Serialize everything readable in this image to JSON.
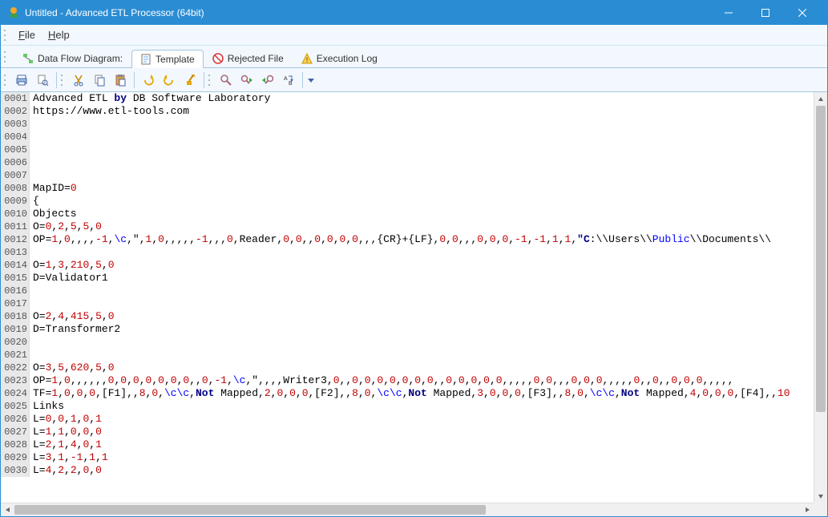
{
  "window": {
    "title": "Untitled - Advanced ETL Processor (64bit)"
  },
  "menu": {
    "file": "File",
    "help": "Help"
  },
  "tabs": {
    "dataflow": "Data Flow Diagram:",
    "template": "Template",
    "rejected": "Rejected File",
    "execlog": "Execution Log"
  },
  "code": {
    "lines": [
      {
        "n": "0001",
        "segs": [
          {
            "t": "Advanced ETL "
          },
          {
            "t": "by",
            "c": "hl-kw"
          },
          {
            "t": " DB Software Laboratory"
          }
        ]
      },
      {
        "n": "0002",
        "segs": [
          {
            "t": "https://www.etl-tools.com"
          }
        ]
      },
      {
        "n": "0003",
        "segs": []
      },
      {
        "n": "0004",
        "segs": []
      },
      {
        "n": "0005",
        "segs": []
      },
      {
        "n": "0006",
        "segs": []
      },
      {
        "n": "0007",
        "segs": []
      },
      {
        "n": "0008",
        "segs": [
          {
            "t": "MapID="
          },
          {
            "t": "0",
            "c": "hl-num"
          }
        ]
      },
      {
        "n": "0009",
        "segs": [
          {
            "t": "{"
          }
        ]
      },
      {
        "n": "0010",
        "segs": [
          {
            "t": "Objects"
          }
        ]
      },
      {
        "n": "0011",
        "segs": [
          {
            "t": "O="
          },
          {
            "t": "0",
            "c": "hl-num"
          },
          {
            "t": ","
          },
          {
            "t": "2",
            "c": "hl-num"
          },
          {
            "t": ","
          },
          {
            "t": "5",
            "c": "hl-num"
          },
          {
            "t": ","
          },
          {
            "t": "5",
            "c": "hl-num"
          },
          {
            "t": ","
          },
          {
            "t": "0",
            "c": "hl-num"
          }
        ]
      },
      {
        "n": "0012",
        "segs": [
          {
            "t": "OP="
          },
          {
            "t": "1",
            "c": "hl-num"
          },
          {
            "t": ","
          },
          {
            "t": "0",
            "c": "hl-num"
          },
          {
            "t": ",,,,"
          },
          {
            "t": "-1",
            "c": "hl-num"
          },
          {
            "t": ","
          },
          {
            "t": "\\c",
            "c": "hl-blue"
          },
          {
            "t": ",\","
          },
          {
            "t": "1",
            "c": "hl-num"
          },
          {
            "t": ","
          },
          {
            "t": "0",
            "c": "hl-num"
          },
          {
            "t": ",,,,,"
          },
          {
            "t": "-1",
            "c": "hl-num"
          },
          {
            "t": ",,,"
          },
          {
            "t": "0",
            "c": "hl-num"
          },
          {
            "t": ",Reader,"
          },
          {
            "t": "0",
            "c": "hl-num"
          },
          {
            "t": ","
          },
          {
            "t": "0",
            "c": "hl-num"
          },
          {
            "t": ",,"
          },
          {
            "t": "0",
            "c": "hl-num"
          },
          {
            "t": ","
          },
          {
            "t": "0",
            "c": "hl-num"
          },
          {
            "t": ","
          },
          {
            "t": "0",
            "c": "hl-num"
          },
          {
            "t": ","
          },
          {
            "t": "0",
            "c": "hl-num"
          },
          {
            "t": ",,,{CR}+{LF},"
          },
          {
            "t": "0",
            "c": "hl-num"
          },
          {
            "t": ","
          },
          {
            "t": "0",
            "c": "hl-num"
          },
          {
            "t": ",,,"
          },
          {
            "t": "0",
            "c": "hl-num"
          },
          {
            "t": ","
          },
          {
            "t": "0",
            "c": "hl-num"
          },
          {
            "t": ","
          },
          {
            "t": "0",
            "c": "hl-num"
          },
          {
            "t": ","
          },
          {
            "t": "-1",
            "c": "hl-num"
          },
          {
            "t": ","
          },
          {
            "t": "-1",
            "c": "hl-num"
          },
          {
            "t": ","
          },
          {
            "t": "1",
            "c": "hl-num"
          },
          {
            "t": ","
          },
          {
            "t": "1",
            "c": "hl-num"
          },
          {
            "t": ","
          },
          {
            "t": "\"C",
            "c": "hl-kw"
          },
          {
            "t": ":\\\\Users\\\\"
          },
          {
            "t": "Public",
            "c": "hl-blue"
          },
          {
            "t": "\\\\Documents\\\\"
          }
        ]
      },
      {
        "n": "0013",
        "segs": []
      },
      {
        "n": "0014",
        "segs": [
          {
            "t": "O="
          },
          {
            "t": "1",
            "c": "hl-num"
          },
          {
            "t": ","
          },
          {
            "t": "3",
            "c": "hl-num"
          },
          {
            "t": ","
          },
          {
            "t": "210",
            "c": "hl-num"
          },
          {
            "t": ","
          },
          {
            "t": "5",
            "c": "hl-num"
          },
          {
            "t": ","
          },
          {
            "t": "0",
            "c": "hl-num"
          }
        ]
      },
      {
        "n": "0015",
        "segs": [
          {
            "t": "D=Validator1"
          }
        ]
      },
      {
        "n": "0016",
        "segs": []
      },
      {
        "n": "0017",
        "segs": []
      },
      {
        "n": "0018",
        "segs": [
          {
            "t": "O="
          },
          {
            "t": "2",
            "c": "hl-num"
          },
          {
            "t": ","
          },
          {
            "t": "4",
            "c": "hl-num"
          },
          {
            "t": ","
          },
          {
            "t": "415",
            "c": "hl-num"
          },
          {
            "t": ","
          },
          {
            "t": "5",
            "c": "hl-num"
          },
          {
            "t": ","
          },
          {
            "t": "0",
            "c": "hl-num"
          }
        ]
      },
      {
        "n": "0019",
        "segs": [
          {
            "t": "D=Transformer2"
          }
        ]
      },
      {
        "n": "0020",
        "segs": []
      },
      {
        "n": "0021",
        "segs": []
      },
      {
        "n": "0022",
        "segs": [
          {
            "t": "O="
          },
          {
            "t": "3",
            "c": "hl-num"
          },
          {
            "t": ","
          },
          {
            "t": "5",
            "c": "hl-num"
          },
          {
            "t": ","
          },
          {
            "t": "620",
            "c": "hl-num"
          },
          {
            "t": ","
          },
          {
            "t": "5",
            "c": "hl-num"
          },
          {
            "t": ","
          },
          {
            "t": "0",
            "c": "hl-num"
          }
        ]
      },
      {
        "n": "0023",
        "segs": [
          {
            "t": "OP="
          },
          {
            "t": "1",
            "c": "hl-num"
          },
          {
            "t": ","
          },
          {
            "t": "0",
            "c": "hl-num"
          },
          {
            "t": ",,,,,,"
          },
          {
            "t": "0",
            "c": "hl-num"
          },
          {
            "t": ","
          },
          {
            "t": "0",
            "c": "hl-num"
          },
          {
            "t": ","
          },
          {
            "t": "0",
            "c": "hl-num"
          },
          {
            "t": ","
          },
          {
            "t": "0",
            "c": "hl-num"
          },
          {
            "t": ","
          },
          {
            "t": "0",
            "c": "hl-num"
          },
          {
            "t": ","
          },
          {
            "t": "0",
            "c": "hl-num"
          },
          {
            "t": ","
          },
          {
            "t": "0",
            "c": "hl-num"
          },
          {
            "t": ",,"
          },
          {
            "t": "0",
            "c": "hl-num"
          },
          {
            "t": ","
          },
          {
            "t": "-1",
            "c": "hl-num"
          },
          {
            "t": ","
          },
          {
            "t": "\\c",
            "c": "hl-blue"
          },
          {
            "t": ",\",,,,Writer3,"
          },
          {
            "t": "0",
            "c": "hl-num"
          },
          {
            "t": ",,"
          },
          {
            "t": "0",
            "c": "hl-num"
          },
          {
            "t": ","
          },
          {
            "t": "0",
            "c": "hl-num"
          },
          {
            "t": ","
          },
          {
            "t": "0",
            "c": "hl-num"
          },
          {
            "t": ","
          },
          {
            "t": "0",
            "c": "hl-num"
          },
          {
            "t": ","
          },
          {
            "t": "0",
            "c": "hl-num"
          },
          {
            "t": ","
          },
          {
            "t": "0",
            "c": "hl-num"
          },
          {
            "t": ","
          },
          {
            "t": "0",
            "c": "hl-num"
          },
          {
            "t": ",,"
          },
          {
            "t": "0",
            "c": "hl-num"
          },
          {
            "t": ","
          },
          {
            "t": "0",
            "c": "hl-num"
          },
          {
            "t": ","
          },
          {
            "t": "0",
            "c": "hl-num"
          },
          {
            "t": ","
          },
          {
            "t": "0",
            "c": "hl-num"
          },
          {
            "t": ","
          },
          {
            "t": "0",
            "c": "hl-num"
          },
          {
            "t": ",,,,,"
          },
          {
            "t": "0",
            "c": "hl-num"
          },
          {
            "t": ","
          },
          {
            "t": "0",
            "c": "hl-num"
          },
          {
            "t": ",,,"
          },
          {
            "t": "0",
            "c": "hl-num"
          },
          {
            "t": ","
          },
          {
            "t": "0",
            "c": "hl-num"
          },
          {
            "t": ","
          },
          {
            "t": "0",
            "c": "hl-num"
          },
          {
            "t": ",,,,,"
          },
          {
            "t": "0",
            "c": "hl-num"
          },
          {
            "t": ",,"
          },
          {
            "t": "0",
            "c": "hl-num"
          },
          {
            "t": ",,"
          },
          {
            "t": "0",
            "c": "hl-num"
          },
          {
            "t": ","
          },
          {
            "t": "0",
            "c": "hl-num"
          },
          {
            "t": ","
          },
          {
            "t": "0",
            "c": "hl-num"
          },
          {
            "t": ",,,,,"
          }
        ]
      },
      {
        "n": "0024",
        "segs": [
          {
            "t": "TF="
          },
          {
            "t": "1",
            "c": "hl-num"
          },
          {
            "t": ","
          },
          {
            "t": "0",
            "c": "hl-num"
          },
          {
            "t": ","
          },
          {
            "t": "0",
            "c": "hl-num"
          },
          {
            "t": ","
          },
          {
            "t": "0",
            "c": "hl-num"
          },
          {
            "t": ",[F1],,"
          },
          {
            "t": "8",
            "c": "hl-num"
          },
          {
            "t": ","
          },
          {
            "t": "0",
            "c": "hl-num"
          },
          {
            "t": ","
          },
          {
            "t": "\\c\\c",
            "c": "hl-blue"
          },
          {
            "t": ","
          },
          {
            "t": "Not",
            "c": "hl-kw"
          },
          {
            "t": " Mapped,"
          },
          {
            "t": "2",
            "c": "hl-num"
          },
          {
            "t": ","
          },
          {
            "t": "0",
            "c": "hl-num"
          },
          {
            "t": ","
          },
          {
            "t": "0",
            "c": "hl-num"
          },
          {
            "t": ","
          },
          {
            "t": "0",
            "c": "hl-num"
          },
          {
            "t": ",[F2],,"
          },
          {
            "t": "8",
            "c": "hl-num"
          },
          {
            "t": ","
          },
          {
            "t": "0",
            "c": "hl-num"
          },
          {
            "t": ","
          },
          {
            "t": "\\c\\c",
            "c": "hl-blue"
          },
          {
            "t": ","
          },
          {
            "t": "Not",
            "c": "hl-kw"
          },
          {
            "t": " Mapped,"
          },
          {
            "t": "3",
            "c": "hl-num"
          },
          {
            "t": ","
          },
          {
            "t": "0",
            "c": "hl-num"
          },
          {
            "t": ","
          },
          {
            "t": "0",
            "c": "hl-num"
          },
          {
            "t": ","
          },
          {
            "t": "0",
            "c": "hl-num"
          },
          {
            "t": ",[F3],,"
          },
          {
            "t": "8",
            "c": "hl-num"
          },
          {
            "t": ","
          },
          {
            "t": "0",
            "c": "hl-num"
          },
          {
            "t": ","
          },
          {
            "t": "\\c\\c",
            "c": "hl-blue"
          },
          {
            "t": ","
          },
          {
            "t": "Not",
            "c": "hl-kw"
          },
          {
            "t": " Mapped,"
          },
          {
            "t": "4",
            "c": "hl-num"
          },
          {
            "t": ","
          },
          {
            "t": "0",
            "c": "hl-num"
          },
          {
            "t": ","
          },
          {
            "t": "0",
            "c": "hl-num"
          },
          {
            "t": ","
          },
          {
            "t": "0",
            "c": "hl-num"
          },
          {
            "t": ",[F4],,"
          },
          {
            "t": "10",
            "c": "hl-num"
          }
        ]
      },
      {
        "n": "0025",
        "segs": [
          {
            "t": "Links"
          }
        ]
      },
      {
        "n": "0026",
        "segs": [
          {
            "t": "L="
          },
          {
            "t": "0",
            "c": "hl-num"
          },
          {
            "t": ","
          },
          {
            "t": "0",
            "c": "hl-num"
          },
          {
            "t": ","
          },
          {
            "t": "1",
            "c": "hl-num"
          },
          {
            "t": ","
          },
          {
            "t": "0",
            "c": "hl-num"
          },
          {
            "t": ","
          },
          {
            "t": "1",
            "c": "hl-num"
          }
        ]
      },
      {
        "n": "0027",
        "segs": [
          {
            "t": "L="
          },
          {
            "t": "1",
            "c": "hl-num"
          },
          {
            "t": ","
          },
          {
            "t": "1",
            "c": "hl-num"
          },
          {
            "t": ","
          },
          {
            "t": "0",
            "c": "hl-num"
          },
          {
            "t": ","
          },
          {
            "t": "0",
            "c": "hl-num"
          },
          {
            "t": ","
          },
          {
            "t": "0",
            "c": "hl-num"
          }
        ]
      },
      {
        "n": "0028",
        "segs": [
          {
            "t": "L="
          },
          {
            "t": "2",
            "c": "hl-num"
          },
          {
            "t": ","
          },
          {
            "t": "1",
            "c": "hl-num"
          },
          {
            "t": ","
          },
          {
            "t": "4",
            "c": "hl-num"
          },
          {
            "t": ","
          },
          {
            "t": "0",
            "c": "hl-num"
          },
          {
            "t": ","
          },
          {
            "t": "1",
            "c": "hl-num"
          }
        ]
      },
      {
        "n": "0029",
        "segs": [
          {
            "t": "L="
          },
          {
            "t": "3",
            "c": "hl-num"
          },
          {
            "t": ","
          },
          {
            "t": "1",
            "c": "hl-num"
          },
          {
            "t": ","
          },
          {
            "t": "-1",
            "c": "hl-num"
          },
          {
            "t": ","
          },
          {
            "t": "1",
            "c": "hl-num"
          },
          {
            "t": ","
          },
          {
            "t": "1",
            "c": "hl-num"
          }
        ]
      },
      {
        "n": "0030",
        "segs": [
          {
            "t": "L="
          },
          {
            "t": "4",
            "c": "hl-num"
          },
          {
            "t": ","
          },
          {
            "t": "2",
            "c": "hl-num"
          },
          {
            "t": ","
          },
          {
            "t": "2",
            "c": "hl-num"
          },
          {
            "t": ","
          },
          {
            "t": "0",
            "c": "hl-num"
          },
          {
            "t": ","
          },
          {
            "t": "0",
            "c": "hl-num"
          }
        ]
      }
    ]
  }
}
